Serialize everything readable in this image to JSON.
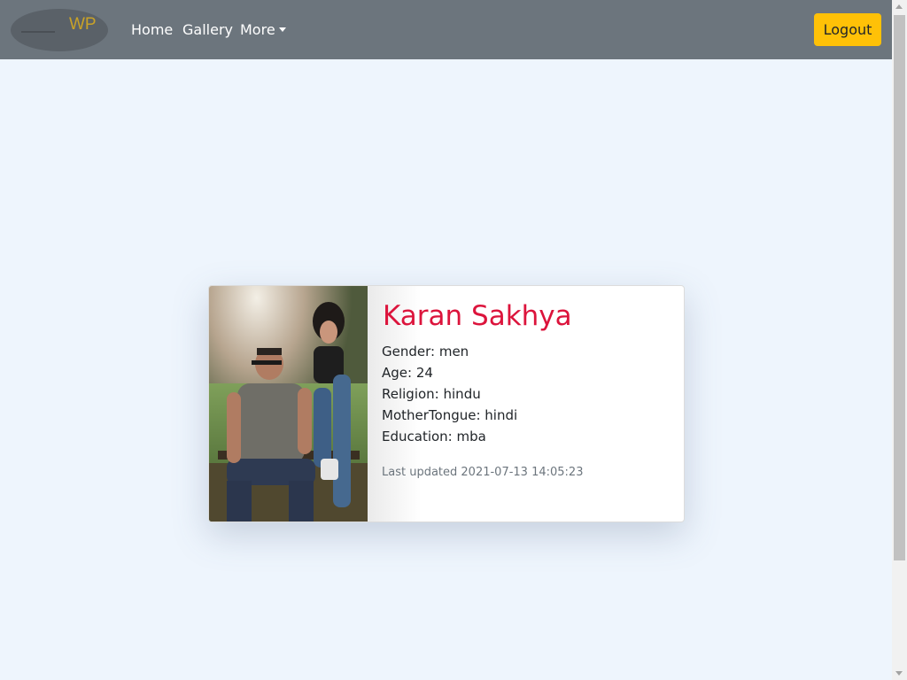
{
  "navbar": {
    "logo_text": "WP",
    "links": [
      {
        "label": "Home"
      },
      {
        "label": "Gallery"
      },
      {
        "label": "More"
      }
    ],
    "logout_label": "Logout"
  },
  "profile": {
    "name": "Karan Sakhya",
    "gender": "Gender: men",
    "age": "Age: 24",
    "religion": "Religion: hindu",
    "mother_tongue": "MotherTongue: hindi",
    "education": "Education: mba",
    "last_updated": "Last updated 2021-07-13 14:05:23"
  },
  "colors": {
    "navbar": "#6c757d",
    "logout_button": "#ffc107",
    "name": "#dc143c",
    "page_background": "#eef5fd"
  }
}
